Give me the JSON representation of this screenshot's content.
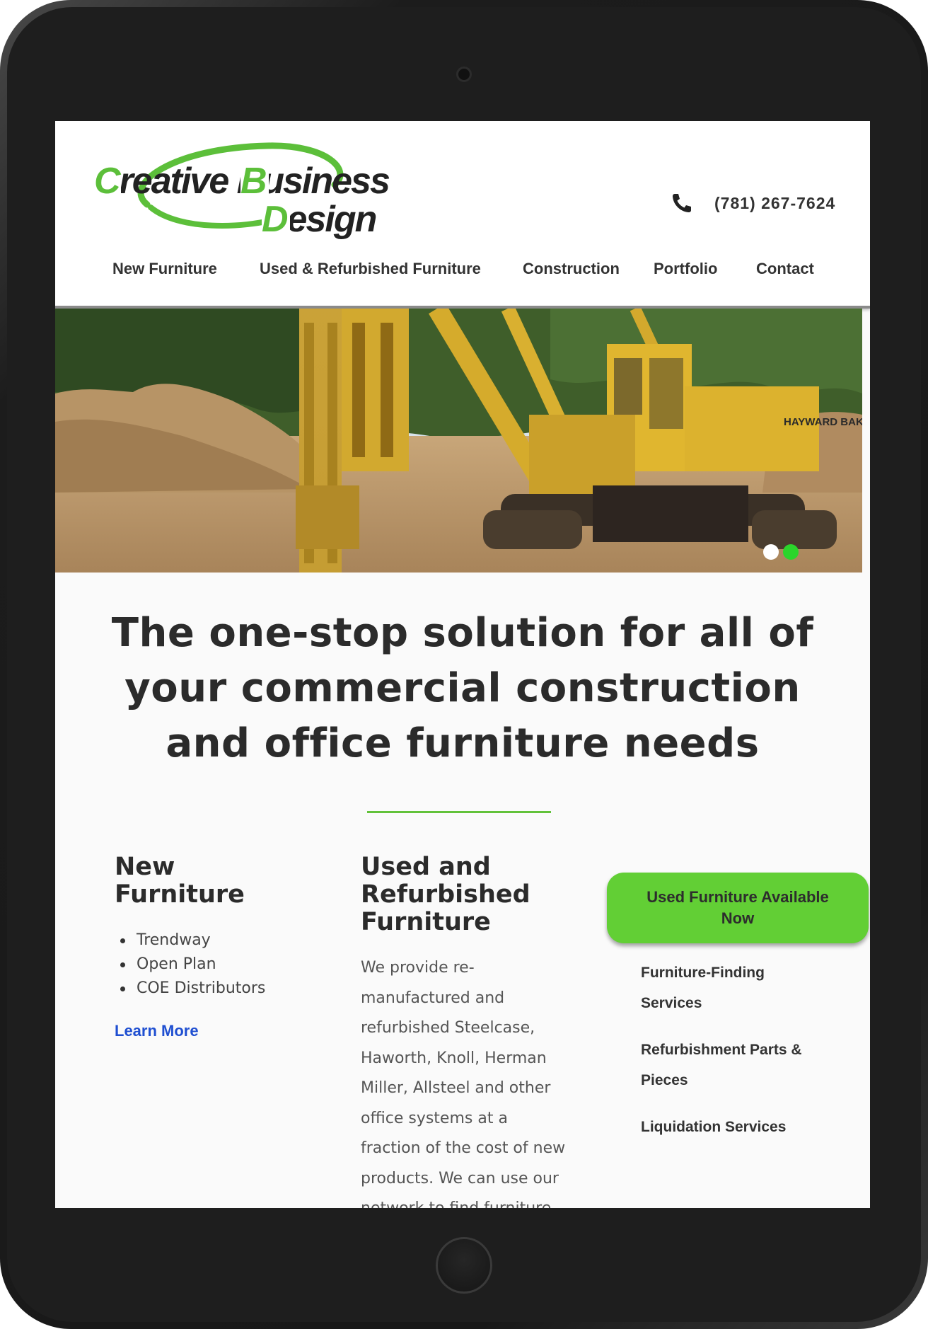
{
  "logo": {
    "line1": "Creative Business",
    "line2": "Design",
    "accent_color": "#5cbf3a"
  },
  "header": {
    "phone": "(781) 267-7624",
    "phone_icon": "phone-icon"
  },
  "nav": {
    "items": [
      {
        "label": "New Furniture"
      },
      {
        "label": "Used & Refurbished Furniture"
      },
      {
        "label": "Construction"
      },
      {
        "label": "Portfolio"
      },
      {
        "label": "Contact"
      }
    ]
  },
  "hero": {
    "equipment_text": "HAYWARD BAKER",
    "slide_count": 2,
    "active_slide": 2,
    "dot_colors": {
      "inactive": "#ffffff",
      "active": "#2bd62b"
    }
  },
  "main": {
    "headline": "The one-stop solution for all of your commercial construction and office furniture needs",
    "divider_color": "#62c23a"
  },
  "col_new": {
    "title_line1": "New",
    "title_line2": "Furniture",
    "bullets": [
      "Trendway",
      "Open Plan",
      "COE Distributors"
    ],
    "link": "Learn More"
  },
  "col_used": {
    "title_line1": "Used and",
    "title_line2": "Refurbished",
    "title_line3": "Furniture",
    "body": "We provide re-manufactured and refurbished Steelcase, Haworth, Knoll, Herman Miller, Allsteel and other office systems at a fraction of the cost of new products.  We can use our network to find furniture"
  },
  "col_services": {
    "cta": "Used Furniture Available Now",
    "cta_color": "#62cf35",
    "items": [
      "Furniture-Finding Services",
      "Refurbishment Parts & Pieces",
      "Liquidation Services"
    ]
  }
}
